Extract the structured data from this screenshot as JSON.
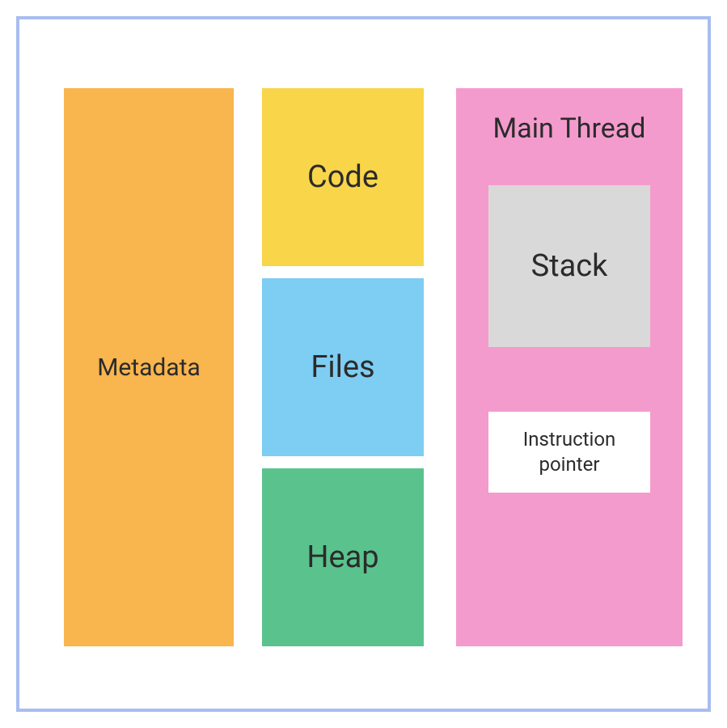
{
  "metadata": {
    "label": "Metadata",
    "color": "#f9b54e"
  },
  "segments": {
    "code": {
      "label": "Code",
      "color": "#f9d549"
    },
    "files": {
      "label": "Files",
      "color": "#7ecdf3"
    },
    "heap": {
      "label": "Heap",
      "color": "#5ac38d"
    }
  },
  "thread": {
    "title": "Main Thread",
    "color": "#f49bcd",
    "stack": {
      "label": "Stack",
      "color": "#d9d9d9"
    },
    "instruction_pointer": {
      "line1": "Instruction",
      "line2": "pointer",
      "color": "#ffffff"
    }
  },
  "frame": {
    "border_color": "#a8bdf0"
  }
}
